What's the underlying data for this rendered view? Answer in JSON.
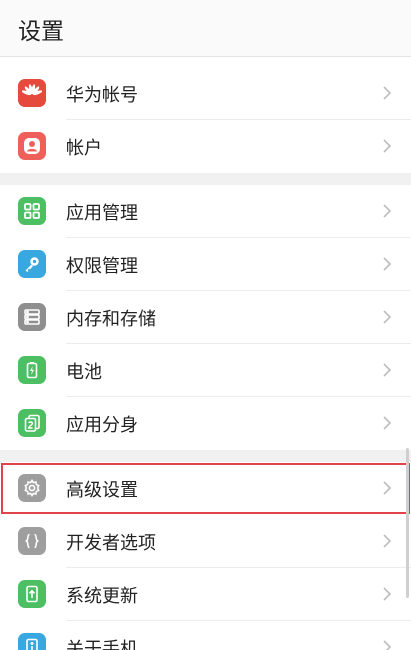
{
  "header": {
    "title": "设置"
  },
  "groups": [
    {
      "items": [
        {
          "label": "华为帐号",
          "icon": "huawei-logo-icon",
          "color": "#e64a3c"
        },
        {
          "label": "帐户",
          "icon": "account-icon",
          "color": "#f0605a"
        }
      ]
    },
    {
      "items": [
        {
          "label": "应用管理",
          "icon": "app-grid-icon",
          "color": "#4cbf62"
        },
        {
          "label": "权限管理",
          "icon": "key-icon",
          "color": "#39a7e0"
        },
        {
          "label": "内存和存储",
          "icon": "storage-icon",
          "color": "#8f8f8f"
        },
        {
          "label": "电池",
          "icon": "battery-icon",
          "color": "#4cbf62"
        },
        {
          "label": "应用分身",
          "icon": "app-clone-icon",
          "color": "#4cbf62"
        },
        {
          "label": "高级设置",
          "icon": "gear-icon",
          "color": "#9e9e9e",
          "highlighted": true
        },
        {
          "label": "开发者选项",
          "icon": "braces-icon",
          "color": "#9e9e9e"
        },
        {
          "label": "系统更新",
          "icon": "system-update-icon",
          "color": "#4cbf62"
        },
        {
          "label": "关于手机",
          "icon": "phone-info-icon",
          "color": "#39a7e0"
        }
      ]
    }
  ]
}
